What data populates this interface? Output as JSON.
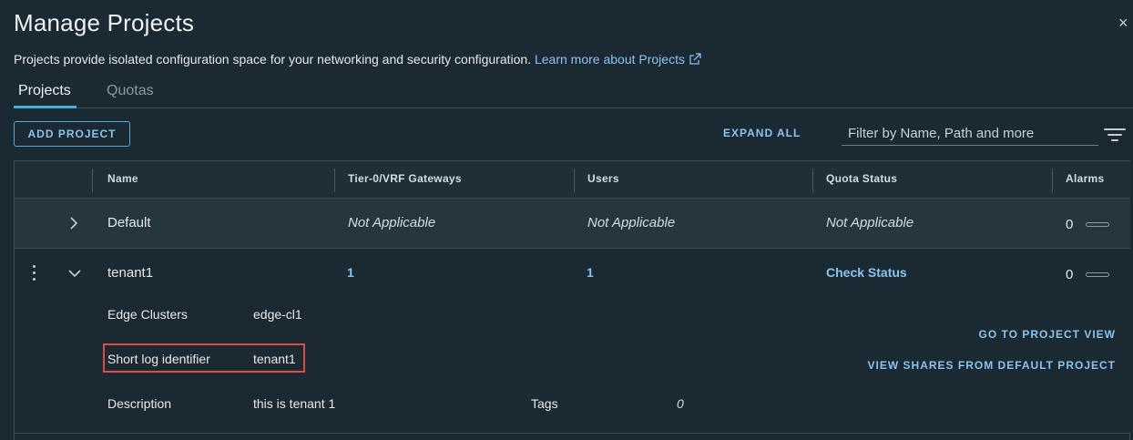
{
  "dialog": {
    "title": "Manage Projects",
    "close_glyph": "×",
    "description": "Projects provide isolated configuration space for your networking and security configuration.",
    "learn_more": "Learn more about Projects"
  },
  "tabs": [
    {
      "label": "Projects",
      "active": true
    },
    {
      "label": "Quotas",
      "active": false
    }
  ],
  "toolbar": {
    "add_project": "ADD PROJECT",
    "expand_all": "EXPAND ALL",
    "filter_placeholder": "Filter by Name, Path and more"
  },
  "table": {
    "columns": [
      "Name",
      "Tier-0/VRF Gateways",
      "Users",
      "Quota Status",
      "Alarms"
    ],
    "rows": [
      {
        "name": "Default",
        "gateways": "Not Applicable",
        "users": "Not Applicable",
        "quota": "Not Applicable",
        "alarms": "0",
        "expanded": false
      },
      {
        "name": "tenant1",
        "gateways": "1",
        "users": "1",
        "quota": "Check Status",
        "alarms": "0",
        "expanded": true,
        "details": {
          "edge_clusters_label": "Edge Clusters",
          "edge_clusters_value": "edge-cl1",
          "short_log_label": "Short log identifier",
          "short_log_value": "tenant1",
          "description_label": "Description",
          "description_value": "this is tenant 1",
          "tags_label": "Tags",
          "tags_value": "0",
          "go_to_project": "GO TO PROJECT VIEW",
          "view_shares": "VIEW SHARES FROM DEFAULT PROJECT"
        }
      }
    ]
  },
  "colors": {
    "background": "#1b2a32",
    "accent": "#89c4ef",
    "highlight": "#e04a46"
  }
}
